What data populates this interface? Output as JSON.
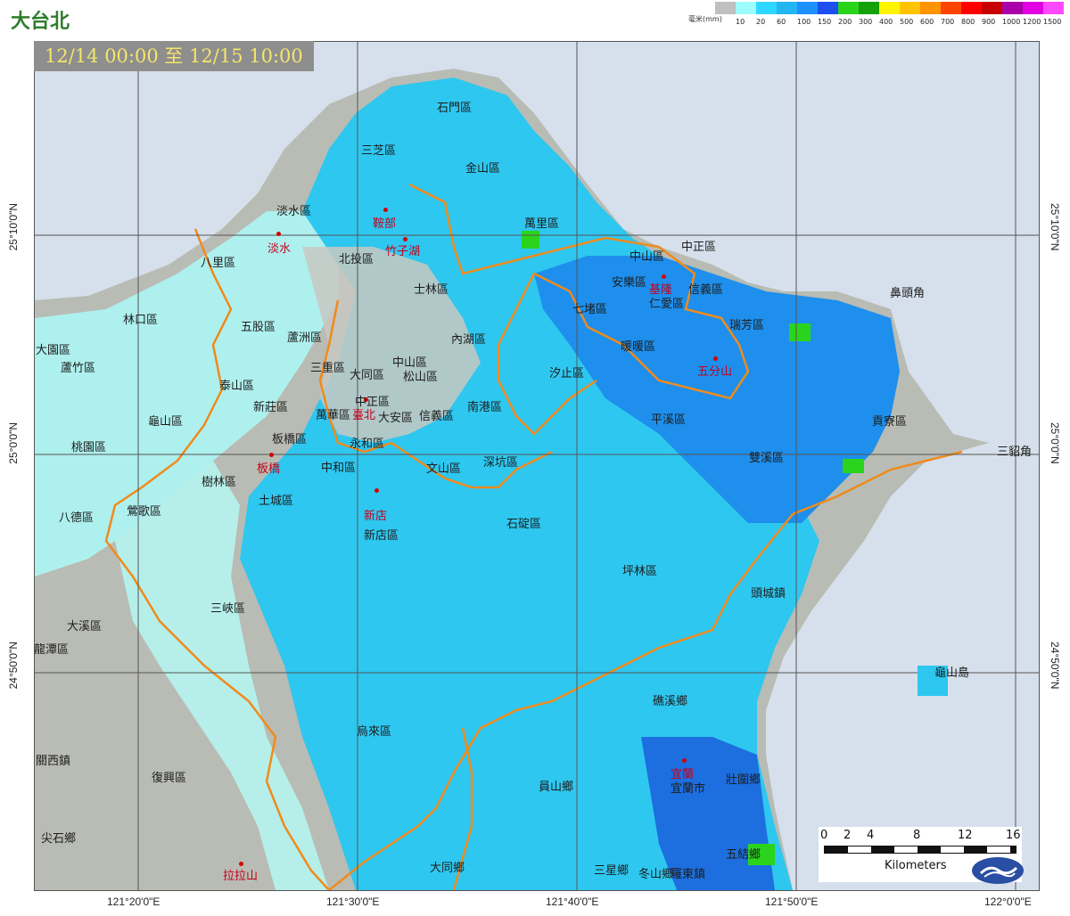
{
  "header": {
    "region_title": "大台北",
    "date_range": "12/14 00:00 至 12/15 10:00"
  },
  "legend": {
    "unit": "毫米(mm)",
    "items": [
      {
        "label": "",
        "color": "#c0c0c0"
      },
      {
        "label": "10",
        "color": "#9efcfe"
      },
      {
        "label": "20",
        "color": "#2ed7ff"
      },
      {
        "label": "60",
        "color": "#22b6f2"
      },
      {
        "label": "100",
        "color": "#1e90ff"
      },
      {
        "label": "150",
        "color": "#1c4ef0"
      },
      {
        "label": "200",
        "color": "#2bd41c"
      },
      {
        "label": "300",
        "color": "#14a10a"
      },
      {
        "label": "400",
        "color": "#fff500"
      },
      {
        "label": "500",
        "color": "#ffc300"
      },
      {
        "label": "600",
        "color": "#ff9300"
      },
      {
        "label": "700",
        "color": "#ff4500"
      },
      {
        "label": "800",
        "color": "#ff0000"
      },
      {
        "label": "900",
        "color": "#c80000"
      },
      {
        "label": "1000",
        "color": "#a800a8"
      },
      {
        "label": "1200",
        "color": "#e100e1"
      },
      {
        "label": "1500",
        "color": "#ff49ff"
      }
    ]
  },
  "axes": {
    "lon_ticks": [
      "121°20'0\"E",
      "121°30'0\"E",
      "121°40'0\"E",
      "121°50'0\"E",
      "122°0'0\"E"
    ],
    "lat_ticks": [
      "25°10'0\"N",
      "25°0'0\"N",
      "24°50'0\"N"
    ]
  },
  "cities": [
    {
      "name": "淡水"
    },
    {
      "name": "鞍部"
    },
    {
      "name": "竹子湖"
    },
    {
      "name": "基隆"
    },
    {
      "name": "五分山"
    },
    {
      "name": "臺北"
    },
    {
      "name": "板橋"
    },
    {
      "name": "新店"
    },
    {
      "name": "宜蘭"
    },
    {
      "name": "拉拉山"
    }
  ],
  "places": [
    {
      "name": "三芝區"
    },
    {
      "name": "石門區"
    },
    {
      "name": "金山區"
    },
    {
      "name": "萬里區"
    },
    {
      "name": "淡水區"
    },
    {
      "name": "北投區"
    },
    {
      "name": "士林區"
    },
    {
      "name": "八里區"
    },
    {
      "name": "林口區"
    },
    {
      "name": "五股區"
    },
    {
      "name": "蘆洲區"
    },
    {
      "name": "三重區"
    },
    {
      "name": "大同區"
    },
    {
      "name": "中山區"
    },
    {
      "name": "松山區"
    },
    {
      "name": "內湖區"
    },
    {
      "name": "南港區"
    },
    {
      "name": "信義區"
    },
    {
      "name": "大安區"
    },
    {
      "name": "萬華區"
    },
    {
      "name": "中正區"
    },
    {
      "name": "永和區"
    },
    {
      "name": "中和區"
    },
    {
      "name": "文山區"
    },
    {
      "name": "深坑區"
    },
    {
      "name": "汐止區"
    },
    {
      "name": "七堵區"
    },
    {
      "name": "暖暖區"
    },
    {
      "name": "安樂區"
    },
    {
      "name": "仁愛區"
    },
    {
      "name": "信義區"
    },
    {
      "name": "中山區"
    },
    {
      "name": "中正區"
    },
    {
      "name": "瑞芳區"
    },
    {
      "name": "平溪區"
    },
    {
      "name": "雙溪區"
    },
    {
      "name": "貢寮區"
    },
    {
      "name": "石碇區"
    },
    {
      "name": "坪林區"
    },
    {
      "name": "新店區"
    },
    {
      "name": "樹林區"
    },
    {
      "name": "土城區"
    },
    {
      "name": "新莊區"
    },
    {
      "name": "泰山區"
    },
    {
      "name": "板橋區"
    },
    {
      "name": "龜山區"
    },
    {
      "name": "桃園區"
    },
    {
      "name": "蘆竹區"
    },
    {
      "name": "大園區"
    },
    {
      "name": "八德區"
    },
    {
      "name": "鶯歌區"
    },
    {
      "name": "三峽區"
    },
    {
      "name": "大溪區"
    },
    {
      "name": "龍潭區"
    },
    {
      "name": "復興區"
    },
    {
      "name": "關西鎮"
    },
    {
      "name": "尖石鄉"
    },
    {
      "name": "烏來區"
    },
    {
      "name": "頭城鎮"
    },
    {
      "name": "礁溪鄉"
    },
    {
      "name": "宜蘭市"
    },
    {
      "name": "壯圍鄉"
    },
    {
      "name": "員山鄉"
    },
    {
      "name": "五結鄉"
    },
    {
      "name": "大同鄉"
    },
    {
      "name": "三星鄉"
    },
    {
      "name": "冬山鄉"
    },
    {
      "name": "羅東鎮"
    },
    {
      "name": "龜山島"
    },
    {
      "name": "三貂角"
    },
    {
      "name": "鼻頭角"
    }
  ],
  "scalebar": {
    "ticks": [
      "0",
      "2",
      "4",
      "8",
      "12",
      "16"
    ],
    "unit": "Kilometers"
  }
}
